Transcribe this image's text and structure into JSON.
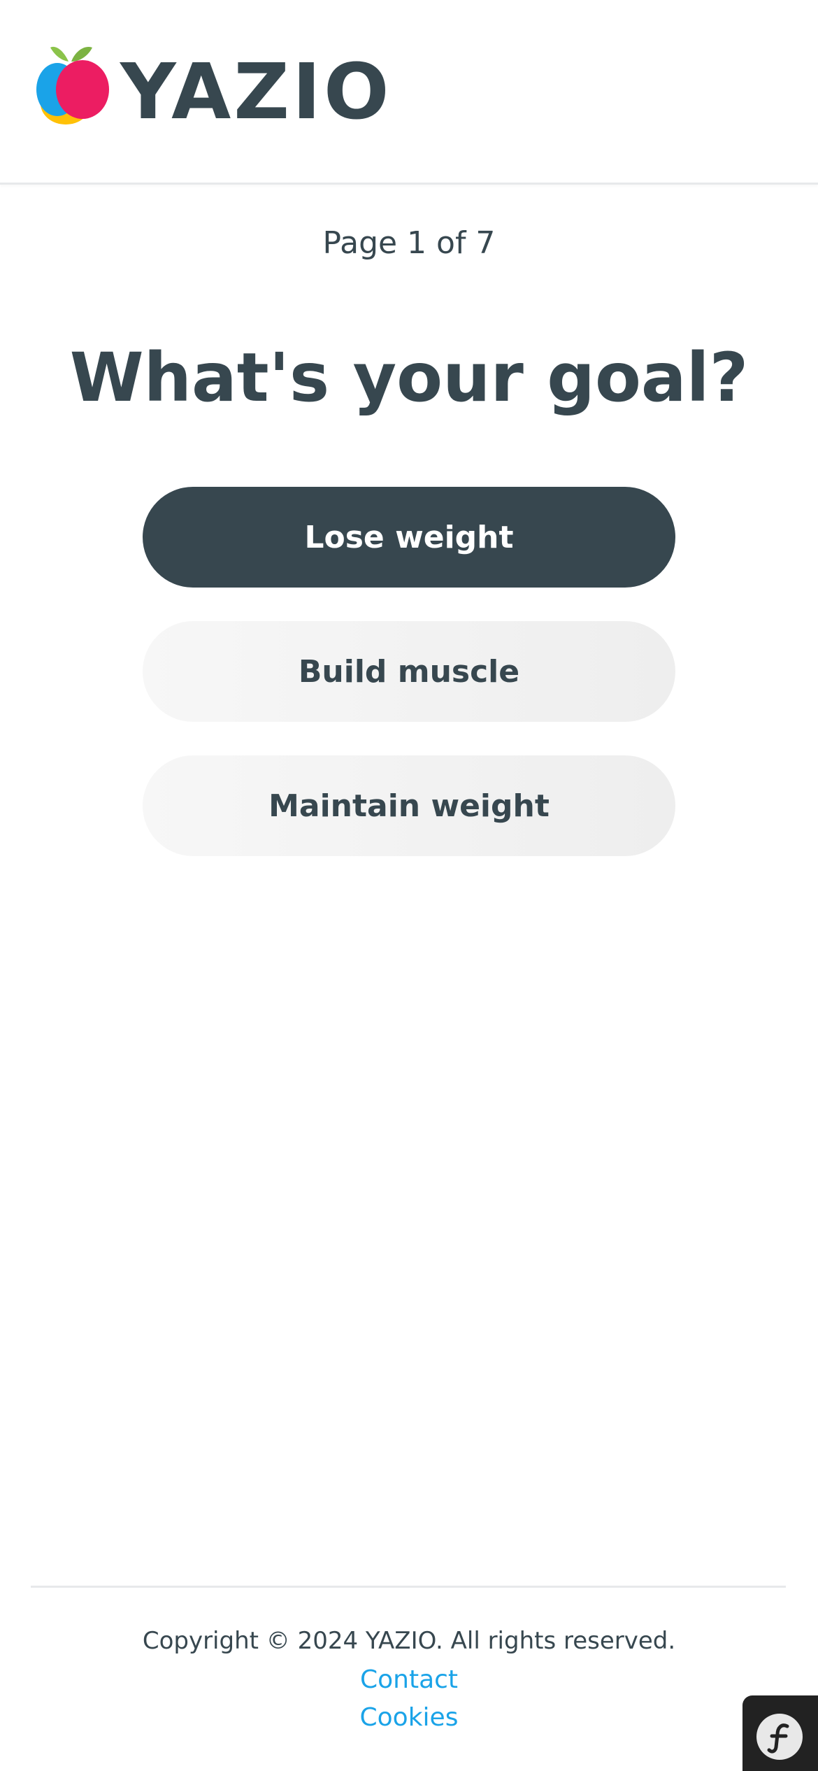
{
  "header": {
    "brand": "YAZIO",
    "logo_icon": "apple-logo-icon",
    "logo_colors": {
      "blue": "#1aa3e8",
      "yellow": "#ffc107",
      "pink": "#ec1d62",
      "leaf": "#8bc34a"
    }
  },
  "progress": {
    "label": "Page 1 of 7",
    "current_page": 1,
    "total_pages": 7
  },
  "main": {
    "title": "What's your goal?",
    "options": [
      {
        "label": "Lose weight",
        "selected": true
      },
      {
        "label": "Build muscle",
        "selected": false
      },
      {
        "label": "Maintain weight",
        "selected": false
      }
    ]
  },
  "footer": {
    "copyright": "Copyright © 2024 YAZIO. All rights reserved.",
    "links": [
      "Contact",
      "Cookies"
    ]
  },
  "debug_toolbar": {
    "icon": "symfony-icon"
  },
  "colors": {
    "text_dark": "#37474f",
    "link": "#1aa3e8",
    "option_bg": "#f2f2f2"
  }
}
